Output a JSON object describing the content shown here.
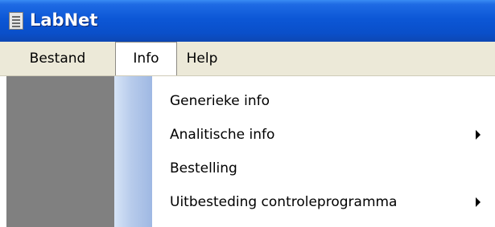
{
  "window": {
    "title": "LabNet",
    "icon": "application-icon"
  },
  "menubar": {
    "items": [
      {
        "label": "Bestand"
      },
      {
        "label": "Info",
        "open": true
      },
      {
        "label": "Help"
      }
    ]
  },
  "dropdown": {
    "items": [
      {
        "label": "Generieke info",
        "submenu": false
      },
      {
        "label": "Analitische info",
        "submenu": true
      },
      {
        "label": "Bestelling",
        "submenu": false
      },
      {
        "label": "Uitbesteding controleprogramma",
        "submenu": true
      }
    ]
  },
  "colors": {
    "titlebar": "#0a4fc9",
    "menubar": "#ece9d8",
    "client_area": "#808080",
    "dropdown_background": "#ffffff",
    "dropdown_strip": "#b7cbeb"
  }
}
